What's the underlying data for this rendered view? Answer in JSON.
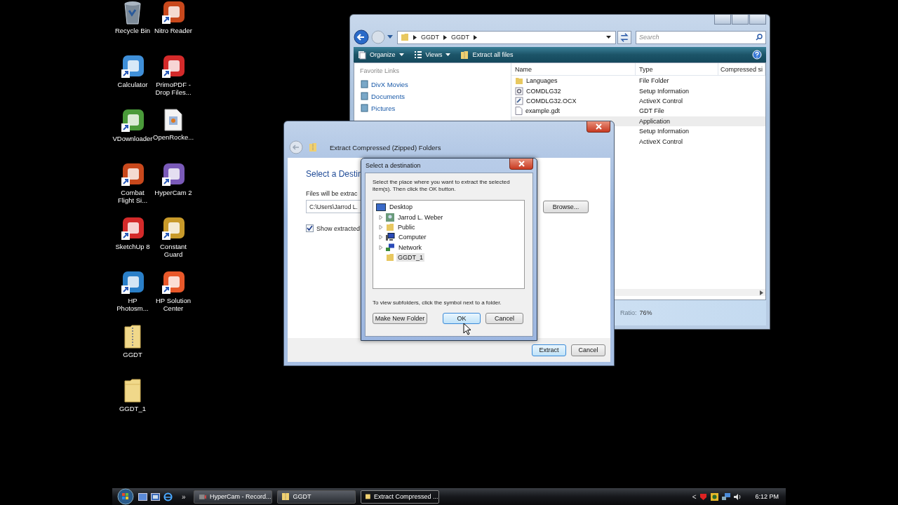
{
  "desktop": {
    "columns": [
      {
        "icons": [
          {
            "label": "Recycle Bin",
            "kind": "bin"
          },
          {
            "label": "Calculator",
            "kind": "app"
          },
          {
            "label": "VDownloader",
            "kind": "app"
          },
          {
            "label": "Combat Flight Si...",
            "kind": "app"
          },
          {
            "label": "SketchUp 8",
            "kind": "app"
          },
          {
            "label": "HP Photosm...",
            "kind": "app"
          },
          {
            "label": "GGDT",
            "kind": "zip"
          },
          {
            "label": "GGDT_1",
            "kind": "folder"
          }
        ]
      },
      {
        "icons": [
          {
            "label": "Nitro Reader",
            "kind": "app"
          },
          {
            "label": "PrimoPDF - Drop Files...",
            "kind": "app"
          },
          {
            "label": "OpenRocke...",
            "kind": "document"
          },
          {
            "label": "HyperCam 2",
            "kind": "app"
          },
          {
            "label": "Constant Guard",
            "kind": "app"
          },
          {
            "label": "HP Solution Center",
            "kind": "app"
          }
        ]
      }
    ]
  },
  "explorer": {
    "breadcrumb": [
      "GGDT",
      "GGDT"
    ],
    "search": {
      "placeholder": "Search"
    },
    "toolbar": [
      {
        "label": "Organize",
        "menu": true
      },
      {
        "label": "Views",
        "menu": true
      },
      {
        "label": "Extract all files",
        "menu": false
      }
    ],
    "favorites_title": "Favorite Links",
    "favorites": [
      "DivX Movies",
      "Documents",
      "Pictures"
    ],
    "columns": [
      "Name",
      "Type",
      "Compressed si"
    ],
    "rows": [
      {
        "name": "Languages",
        "type": "File Folder",
        "kind": "folder",
        "selected": false
      },
      {
        "name": "COMDLG32",
        "type": "Setup Information",
        "kind": "setup",
        "selected": false
      },
      {
        "name": "COMDLG32.OCX",
        "type": "ActiveX Control",
        "kind": "ocx",
        "selected": false
      },
      {
        "name": "example.gdt",
        "type": "GDT File",
        "kind": "file",
        "selected": false
      },
      {
        "type": "Application",
        "selected": true
      },
      {
        "type": "Setup Information",
        "selected": false
      },
      {
        "type": "ActiveX Control",
        "selected": false
      }
    ],
    "status": {
      "label": "Ratio:",
      "value": "76%"
    }
  },
  "extract_dialog": {
    "title": "Extract Compressed (Zipped) Folders",
    "heading": "Select a Destin",
    "files_label": "Files will be extrac",
    "path": "C:\\Users\\Jarrod L.",
    "browse": "Browse...",
    "show_files": {
      "label": "Show extracted",
      "checked": true
    },
    "buttons": [
      "Extract",
      "Cancel"
    ]
  },
  "destination_dialog": {
    "title": "Select a destination",
    "instruction": "Select the place where you want to extract the selected item(s).  Then click the OK button.",
    "tree": [
      {
        "label": "Desktop",
        "kind": "desktop",
        "expanded": true,
        "selected": false,
        "children": [
          {
            "label": "Jarrod L. Weber",
            "kind": "user",
            "expandable": true,
            "selected": false
          },
          {
            "label": "Public",
            "kind": "folder",
            "expandable": true,
            "selected": false
          },
          {
            "label": "Computer",
            "kind": "computer",
            "expandable": true,
            "selected": false
          },
          {
            "label": "Network",
            "kind": "network",
            "expandable": true,
            "selected": false
          },
          {
            "label": "GGDT_1",
            "kind": "folder",
            "expandable": false,
            "selected": true
          }
        ]
      }
    ],
    "hint": "To view subfolders, click the symbol next to a folder.",
    "buttons": [
      {
        "label": "Make New Folder",
        "default": false
      },
      {
        "label": "OK",
        "default": true
      },
      {
        "label": "Cancel",
        "default": false
      }
    ]
  },
  "taskbar": {
    "more": "»",
    "buttons": [
      {
        "label": "HyperCam - Record...",
        "kind": "camera",
        "selected": false
      },
      {
        "label": "GGDT",
        "kind": "zip",
        "selected": false
      },
      {
        "label": "Extract Compressed ...",
        "kind": "folder",
        "selected": true
      }
    ],
    "tray_toggle": "<",
    "clock": "6:12 PM"
  }
}
